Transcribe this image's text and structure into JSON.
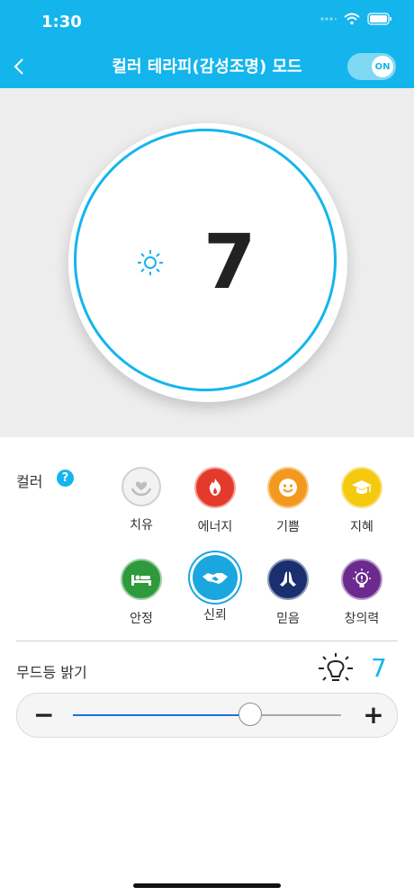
{
  "status": {
    "time": "1:30"
  },
  "header": {
    "back_label": "<",
    "title": "컬러 테라피(감성조명) 모드",
    "toggle_label": "ON"
  },
  "dial": {
    "value": "7"
  },
  "colors": {
    "label": "컬러",
    "help": "?",
    "items": [
      {
        "label": "치유",
        "icon": "healing-heart-hands-icon",
        "color": "#e6e6e6"
      },
      {
        "label": "에너지",
        "icon": "energy-flame-icon",
        "color": "#e43a2b"
      },
      {
        "label": "기쁨",
        "icon": "joy-smiley-icon",
        "color": "#f29a1d"
      },
      {
        "label": "지혜",
        "icon": "wisdom-graduation-cap-icon",
        "color": "#f5c90d"
      },
      {
        "label": "안정",
        "icon": "stability-bed-icon",
        "color": "#2e9a3b"
      },
      {
        "label": "신뢰",
        "icon": "trust-handshake-icon",
        "color": "#1aa7df"
      },
      {
        "label": "믿음",
        "icon": "faith-praying-hands-icon",
        "color": "#1b2f6f"
      },
      {
        "label": "창의력",
        "icon": "creativity-lightbulb-icon",
        "color": "#6c2a8f"
      }
    ]
  },
  "brightness": {
    "label": "무드등 밝기",
    "value": "7",
    "minus": "−",
    "plus": "+",
    "level_fraction": 0.66
  },
  "accent": "#14b5ec"
}
